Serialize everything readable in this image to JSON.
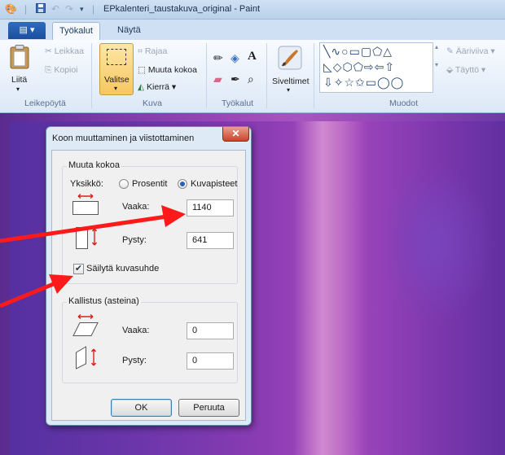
{
  "window": {
    "title": "EPkalenteri_taustakuva_original - Paint"
  },
  "ribbon": {
    "file_tab": "▤ ▾",
    "tabs": [
      "Työkalut",
      "Näytä"
    ],
    "groups": {
      "clipboard": {
        "paste": "Liitä",
        "cut": "Leikkaa",
        "copy": "Kopioi",
        "label": "Leikepöytä"
      },
      "image": {
        "select": "Valitse",
        "crop": "Rajaa",
        "resize": "Muuta kokoa",
        "rotate": "Kierrä",
        "label": "Kuva"
      },
      "tools": {
        "label": "Työkalut"
      },
      "brushes": {
        "label": "Siveltimet"
      },
      "shapes": {
        "outline": "Ääriviiva",
        "fill": "Täyttö",
        "label": "Muodot"
      }
    }
  },
  "dialog": {
    "title": "Koon muuttaminen ja viistottaminen",
    "resize_group": {
      "title": "Muuta kokoa",
      "unit_label": "Yksikkö:",
      "unit_percent": "Prosentit",
      "unit_pixels": "Kuvapisteet",
      "horizontal_label": "Vaaka:",
      "horizontal_value": "1140",
      "vertical_label": "Pysty:",
      "vertical_value": "641",
      "keep_ratio_label": "Säilytä kuvasuhde",
      "keep_ratio_checked": true
    },
    "skew_group": {
      "title": "Kallistus (asteina)",
      "horizontal_label": "Vaaka:",
      "horizontal_value": "0",
      "vertical_label": "Pysty:",
      "vertical_value": "0"
    },
    "ok": "OK",
    "cancel": "Peruuta"
  },
  "colors": {
    "arrow": "#ff1a1a",
    "canvas": "#8a3fb0"
  }
}
